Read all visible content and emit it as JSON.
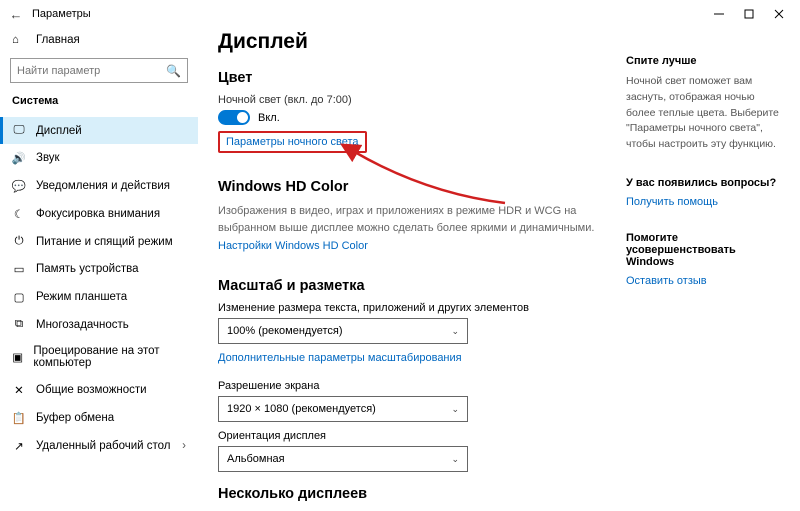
{
  "titlebar": {
    "title": "Параметры"
  },
  "sidebar": {
    "home": "Главная",
    "search_placeholder": "Найти параметр",
    "header": "Система",
    "items": [
      {
        "label": "Дисплей"
      },
      {
        "label": "Звук"
      },
      {
        "label": "Уведомления и действия"
      },
      {
        "label": "Фокусировка внимания"
      },
      {
        "label": "Питание и спящий режим"
      },
      {
        "label": "Память устройства"
      },
      {
        "label": "Режим планшета"
      },
      {
        "label": "Многозадачность"
      },
      {
        "label": "Проецирование на этот компьютер"
      },
      {
        "label": "Общие возможности"
      },
      {
        "label": "Буфер обмена"
      },
      {
        "label": "Удаленный рабочий стол"
      }
    ]
  },
  "main": {
    "title": "Дисплей",
    "color": {
      "heading": "Цвет",
      "night_light_label": "Ночной свет (вкл. до 7:00)",
      "toggle_state": "Вкл.",
      "settings_link": "Параметры ночного света"
    },
    "hdcolor": {
      "heading": "Windows HD Color",
      "desc": "Изображения в видео, играх и приложениях в режиме HDR и WCG на выбранном выше дисплее можно сделать более яркими и динамичными.",
      "link": "Настройки Windows HD Color"
    },
    "scale": {
      "heading": "Масштаб и разметка",
      "size_label": "Изменение размера текста, приложений и других элементов",
      "size_value": "100% (рекомендуется)",
      "adv_link": "Дополнительные параметры масштабирования",
      "res_label": "Разрешение экрана",
      "res_value": "1920 × 1080 (рекомендуется)",
      "orient_label": "Ориентация дисплея",
      "orient_value": "Альбомная"
    },
    "multi": {
      "heading": "Несколько дисплеев"
    }
  },
  "right": {
    "sleep": {
      "title": "Спите лучше",
      "desc": "Ночной свет поможет вам заснуть, отображая ночью более теплые цвета. Выберите \"Параметры ночного света\", чтобы настроить эту функцию."
    },
    "q": {
      "title": "У вас появились вопросы?",
      "link": "Получить помощь"
    },
    "fb": {
      "title": "Помогите усовершенствовать Windows",
      "link": "Оставить отзыв"
    }
  }
}
